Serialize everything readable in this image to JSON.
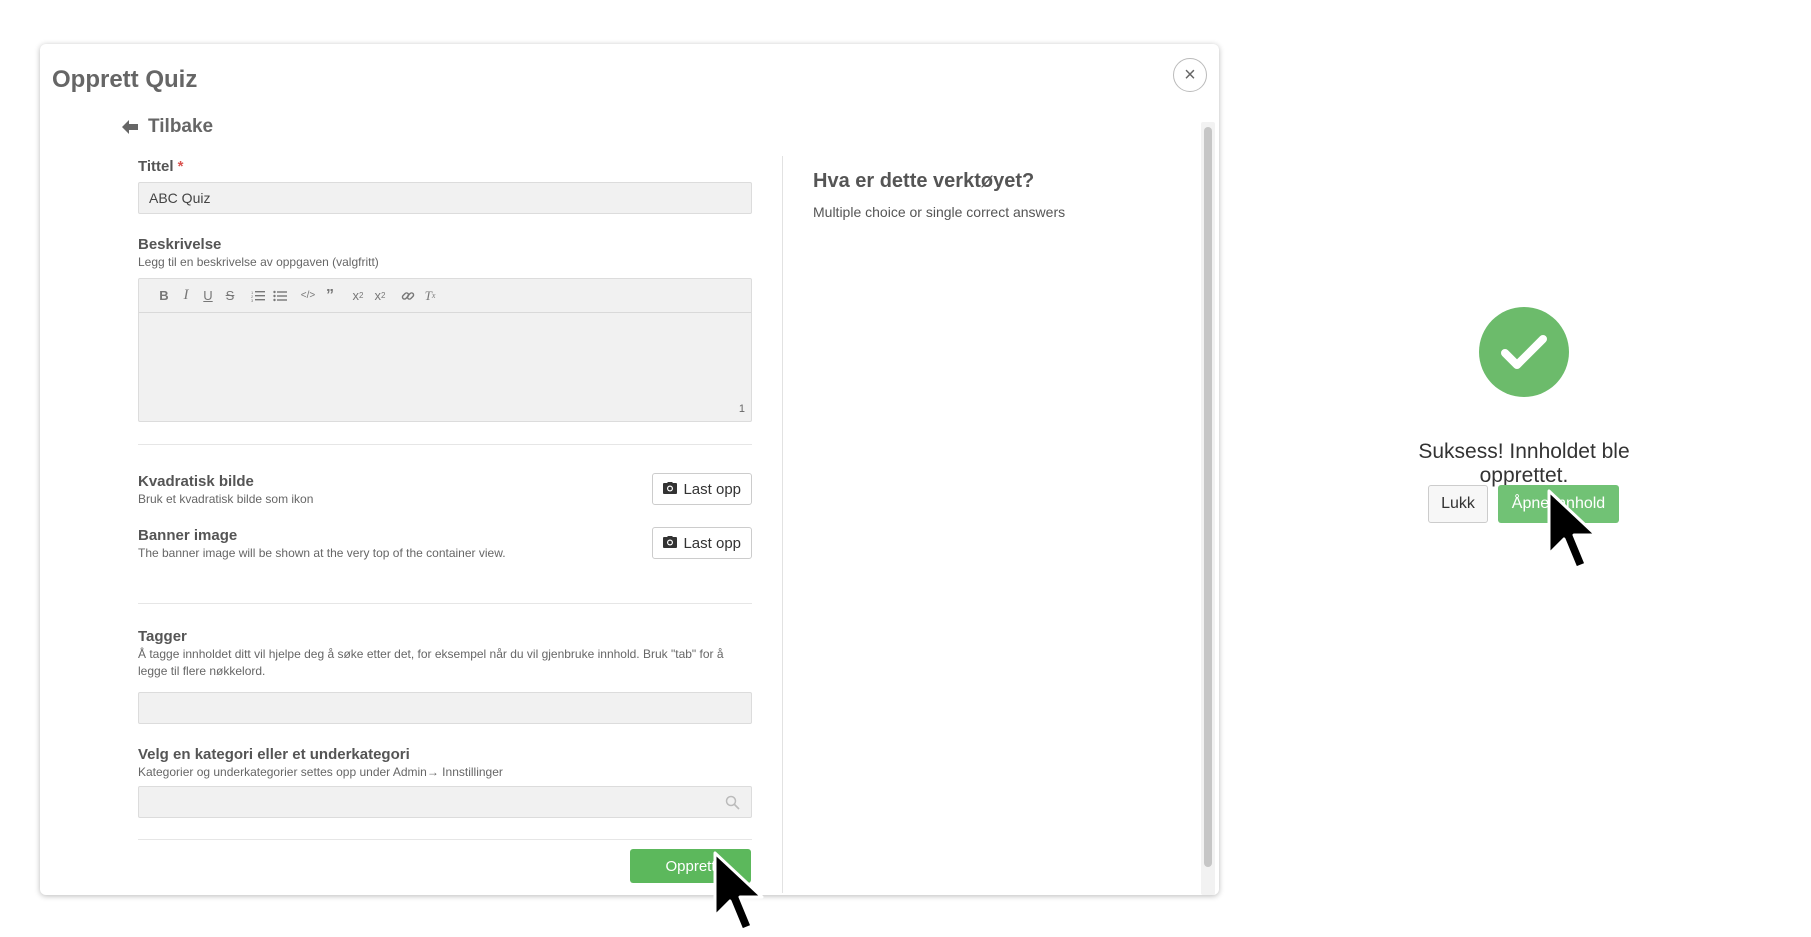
{
  "modal": {
    "title": "Opprett Quiz",
    "close_label": "×",
    "back_label": "Tilbake"
  },
  "form": {
    "title_label": "Tittel",
    "required_mark": "*",
    "title_value": "ABC Quiz",
    "description_label": "Beskrivelse",
    "description_help": "Legg til en beskrivelse av oppgaven (valgfritt)",
    "editor_toolbar": [
      "bold-icon",
      "italic-icon",
      "underline-icon",
      "strikethrough-icon",
      "ordered-list-icon",
      "bullet-list-icon",
      "code-icon",
      "blockquote-icon",
      "subscript-icon",
      "superscript-icon",
      "link-icon",
      "clear-format-icon"
    ],
    "char_count": "1",
    "square_image_label": "Kvadratisk bilde",
    "square_image_help": "Bruk et kvadratisk bilde som ikon",
    "square_image_button": "Last opp",
    "banner_label": "Banner image",
    "banner_help": "The banner image will be shown at the very top of the container view.",
    "banner_button": "Last opp",
    "tags_label": "Tagger",
    "tags_help": "Å tagge innholdet ditt vil hjelpe deg å søke etter det, for eksempel når du vil gjenbruke innhold. Bruk \"tab\" for å legge til flere nøkkelord.",
    "tags_value": "",
    "category_label": "Velg en kategori eller et underkategori",
    "category_help": "Kategorier og underkategorier settes opp under Admin→ Innstillinger",
    "category_value": "",
    "submit_label": "Opprett"
  },
  "info": {
    "heading": "Hva er dette verktøyet?",
    "description": "Multiple choice or single correct answers"
  },
  "success": {
    "message": "Suksess! Innholdet ble opprettet.",
    "close_label": "Lukk",
    "open_label": "Åpne innhold",
    "color": "#6cbb6b"
  },
  "colors": {
    "primary_green": "#5cb85c",
    "required": "#d9534f"
  }
}
